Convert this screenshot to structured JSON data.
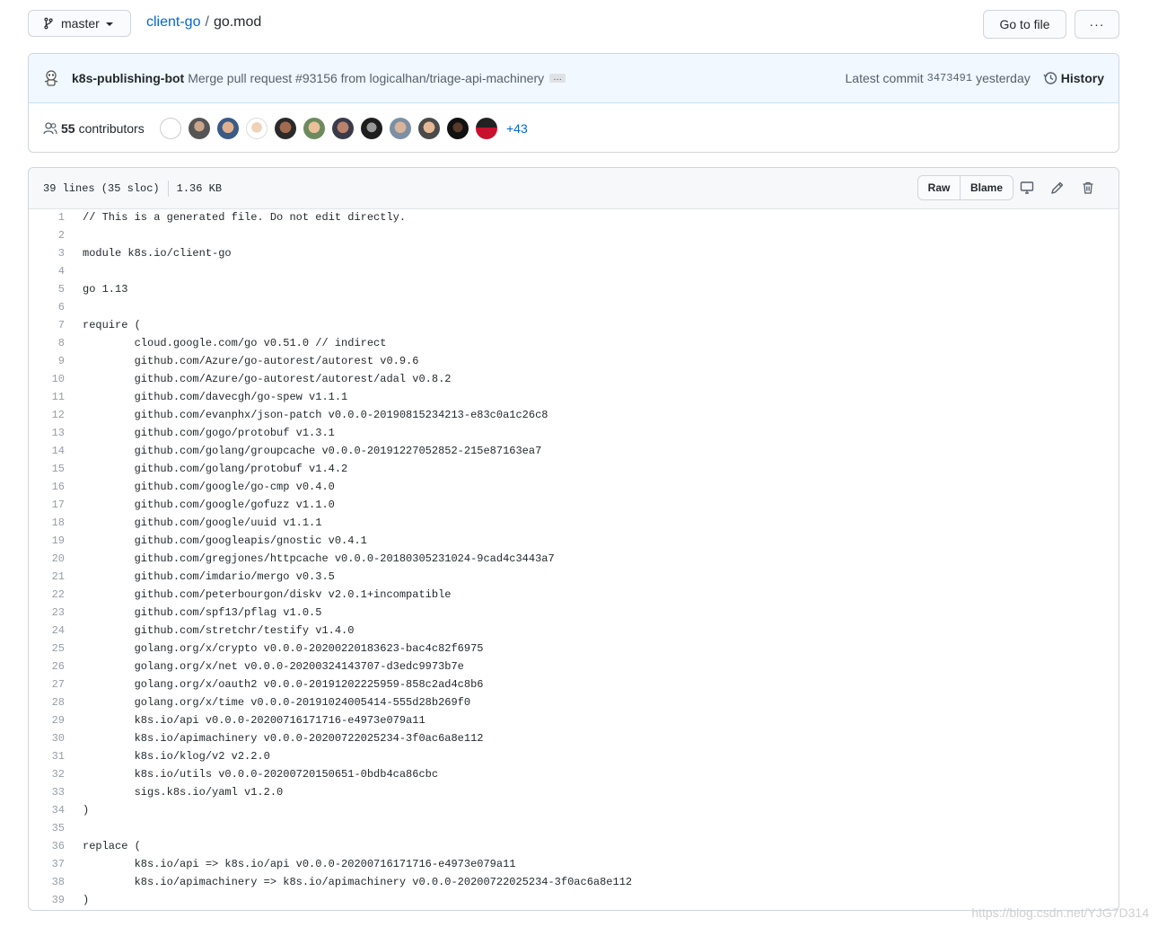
{
  "branch": {
    "name": "master"
  },
  "breadcrumb": {
    "repo": "client-go",
    "separator": "/",
    "file": "go.mod"
  },
  "actions": {
    "goto_file": "Go to file",
    "more": "···"
  },
  "commit": {
    "author": "k8s-publishing-bot",
    "message": "Merge pull request #93156 from logicalhan/triage-api-machinery",
    "ellipsis": "…",
    "latest_label": "Latest commit",
    "sha": "3473491",
    "time": "yesterday",
    "history": "History"
  },
  "contributors": {
    "count": "55",
    "label": "contributors",
    "more": "+43"
  },
  "file": {
    "lines": "39 lines (35 sloc)",
    "size": "1.36 KB",
    "raw": "Raw",
    "blame": "Blame"
  },
  "code_lines": [
    "// This is a generated file. Do not edit directly.",
    "",
    "module k8s.io/client-go",
    "",
    "go 1.13",
    "",
    "require (",
    "\tcloud.google.com/go v0.51.0 // indirect",
    "\tgithub.com/Azure/go-autorest/autorest v0.9.6",
    "\tgithub.com/Azure/go-autorest/autorest/adal v0.8.2",
    "\tgithub.com/davecgh/go-spew v1.1.1",
    "\tgithub.com/evanphx/json-patch v0.0.0-20190815234213-e83c0a1c26c8",
    "\tgithub.com/gogo/protobuf v1.3.1",
    "\tgithub.com/golang/groupcache v0.0.0-20191227052852-215e87163ea7",
    "\tgithub.com/golang/protobuf v1.4.2",
    "\tgithub.com/google/go-cmp v0.4.0",
    "\tgithub.com/google/gofuzz v1.1.0",
    "\tgithub.com/google/uuid v1.1.1",
    "\tgithub.com/googleapis/gnostic v0.4.1",
    "\tgithub.com/gregjones/httpcache v0.0.0-20180305231024-9cad4c3443a7",
    "\tgithub.com/imdario/mergo v0.3.5",
    "\tgithub.com/peterbourgon/diskv v2.0.1+incompatible",
    "\tgithub.com/spf13/pflag v1.0.5",
    "\tgithub.com/stretchr/testify v1.4.0",
    "\tgolang.org/x/crypto v0.0.0-20200220183623-bac4c82f6975",
    "\tgolang.org/x/net v0.0.0-20200324143707-d3edc9973b7e",
    "\tgolang.org/x/oauth2 v0.0.0-20191202225959-858c2ad4c8b6",
    "\tgolang.org/x/time v0.0.0-20191024005414-555d28b269f0",
    "\tk8s.io/api v0.0.0-20200716171716-e4973e079a11",
    "\tk8s.io/apimachinery v0.0.0-20200722025234-3f0ac6a8e112",
    "\tk8s.io/klog/v2 v2.2.0",
    "\tk8s.io/utils v0.0.0-20200720150651-0bdb4ca86cbc",
    "\tsigs.k8s.io/yaml v1.2.0",
    ")",
    "",
    "replace (",
    "\tk8s.io/api => k8s.io/api v0.0.0-20200716171716-e4973e079a11",
    "\tk8s.io/apimachinery => k8s.io/apimachinery v0.0.0-20200722025234-3f0ac6a8e112",
    ")"
  ],
  "icons": {
    "branch": "git-branch-icon",
    "history": "history-icon",
    "people": "people-icon",
    "desktop": "desktop-icon",
    "edit": "pencil-icon",
    "delete": "trash-icon"
  },
  "watermark": "https://blog.csdn.net/YJG7D314"
}
